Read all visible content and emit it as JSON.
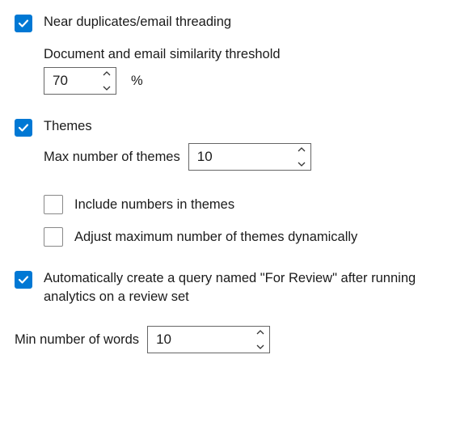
{
  "near_dup": {
    "checked": true,
    "label": "Near duplicates/email threading",
    "threshold_label": "Document and email similarity threshold",
    "threshold_value": "70",
    "unit": "%"
  },
  "themes": {
    "checked": true,
    "label": "Themes",
    "max_label": "Max number of themes",
    "max_value": "10",
    "include_numbers": {
      "checked": false,
      "label": "Include numbers in themes"
    },
    "adjust_dynamic": {
      "checked": false,
      "label": "Adjust maximum number of themes dynamically"
    }
  },
  "auto_query": {
    "checked": true,
    "label": "Automatically create a query named \"For Review\" after running analytics on a review set"
  },
  "min_words": {
    "label": "Min number of words",
    "value": "10"
  }
}
